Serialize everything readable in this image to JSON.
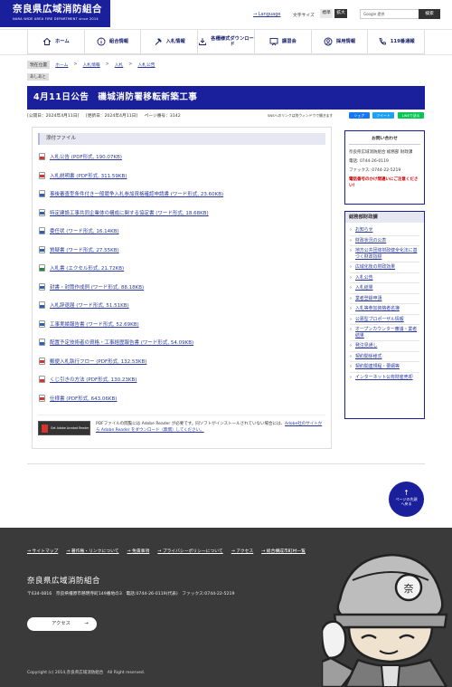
{
  "header": {
    "logo_title": "奈良県広域消防組合",
    "logo_sub": "NARA WIDE AREA FIRE DEPARTMENT since 2014",
    "language": "Language",
    "font_size_label": "文字サイズ",
    "font_standard": "標準",
    "font_large": "拡大",
    "search_placeholder": "Google 提供",
    "search_button": "検索"
  },
  "nav": [
    {
      "label": "ホーム",
      "icon": "home-icon"
    },
    {
      "label": "組合情報",
      "icon": "info-icon"
    },
    {
      "label": "入札情報",
      "icon": "hammer-icon"
    },
    {
      "label": "各種様式ダウンロード",
      "icon": "download-icon"
    },
    {
      "label": "講習会",
      "icon": "lecture-icon"
    },
    {
      "label": "採用情報",
      "icon": "person-icon"
    },
    {
      "label": "119番通報",
      "icon": "phone-icon"
    }
  ],
  "breadcrumb": {
    "here": "現在位置",
    "items": [
      "ホーム",
      "入札情報",
      "入札",
      "入札公告"
    ]
  },
  "print": "あしあと",
  "title": "4月11日公告　磯城消防署移転新築工事",
  "meta": {
    "published": "[公開日：2024年4月11日]",
    "updated": "[更新日：2024年4月11日]",
    "page_id": "ページ番号：3142"
  },
  "sns": {
    "note": "SNSへのリンクは別ウィンドウで開きます",
    "share": "シェア",
    "tweet": "ツイート",
    "line": "LINEで送る"
  },
  "attachments": {
    "heading": "添付ファイル",
    "files": [
      {
        "label": "入札公告 (PDF形式, 190.07KB)",
        "type": "pdf"
      },
      {
        "label": "入札説明書 (PDF形式, 311.59KB)",
        "type": "pdf"
      },
      {
        "label": "事後審査型条件付き一般競争入札参加資格確認申請書 (ワード形式, 23.60KB)",
        "type": "word"
      },
      {
        "label": "特定建設工事共同企業体の構成に関する協定書 (ワード形式, 18.68KB)",
        "type": "word"
      },
      {
        "label": "委任状 (ワード形式, 16.14KB)",
        "type": "word"
      },
      {
        "label": "質疑書 (ワード形式, 27.55KB)",
        "type": "word"
      },
      {
        "label": "入札書 (エクセル形式, 21.72KB)",
        "type": "xls"
      },
      {
        "label": "封書・封筒作成例 (ワード形式, 88.18KB)",
        "type": "word"
      },
      {
        "label": "入札辞退届 (ワード形式, 51.51KB)",
        "type": "word"
      },
      {
        "label": "工事実績報告書 (ワード形式, 52.69KB)",
        "type": "word"
      },
      {
        "label": "配置予定技術者の資格・工事経歴報告書 (ワード形式, 54.09KB)",
        "type": "word"
      },
      {
        "label": "郵便入札執行フロー (PDF形式, 132.53KB)",
        "type": "pdf"
      },
      {
        "label": "くじ引きの方法 (PDF形式, 130.23KB)",
        "type": "pdf"
      },
      {
        "label": "仕様書 (PDF形式, 643.06KB)",
        "type": "pdf"
      }
    ],
    "adobe_logo": "Get Adobe Acrobat Reader",
    "adobe_text": "PDFファイルの閲覧には Adobe Reader が必要です。同ソフトがインストールされていない場合には、",
    "adobe_link": "Adobe社のサイトから Adobe Reader をダウンロード（無償）してください。"
  },
  "inquiry": {
    "heading": "お問い合わせ",
    "org": "奈良県広域消防組合 総務部 財政課",
    "tel": "電話: 0744-26-0119",
    "fax": "ファックス: 0744-22-5219",
    "warn": "電話番号のかけ間違いにご注意ください!"
  },
  "related": {
    "heading": "総務部財政課",
    "items": [
      "お知らせ",
      "財政状況の公表",
      "地方公共団体財政健全化法に基づく財政指標",
      "広域化後の財政効果",
      "入札公告",
      "入札結果",
      "業者登録申請",
      "入札等参加資格者名簿",
      "公募型プロポーザル情報",
      "オープンカウンター審議・業者結果",
      "発注見通し",
      "契約関係様式",
      "契約関連規程・要綱等",
      "インターネット公有財産売却"
    ]
  },
  "to_top": {
    "arrow": "↑",
    "label": "ページの先頭へ戻る"
  },
  "footer": {
    "links": [
      "サイトマップ",
      "著作権・リンクについて",
      "免責事項",
      "プライバシーポリシーについて",
      "アクセス",
      "総合構成市町村一覧"
    ],
    "org": "奈良県広域消防組合",
    "address": "〒634-0816　奈良県橿原市慈明寺町149番地の3　電話:0744-26-0119(代表)　ファックス:0744-22-5219",
    "access": "アクセス",
    "copyright": "Copyright (c) 2014,奈良県広域消防組合　All Right reserved."
  },
  "colors": {
    "brand": "#1a1f9c",
    "footer": "#3a3a3a",
    "warning": "#d60000"
  }
}
